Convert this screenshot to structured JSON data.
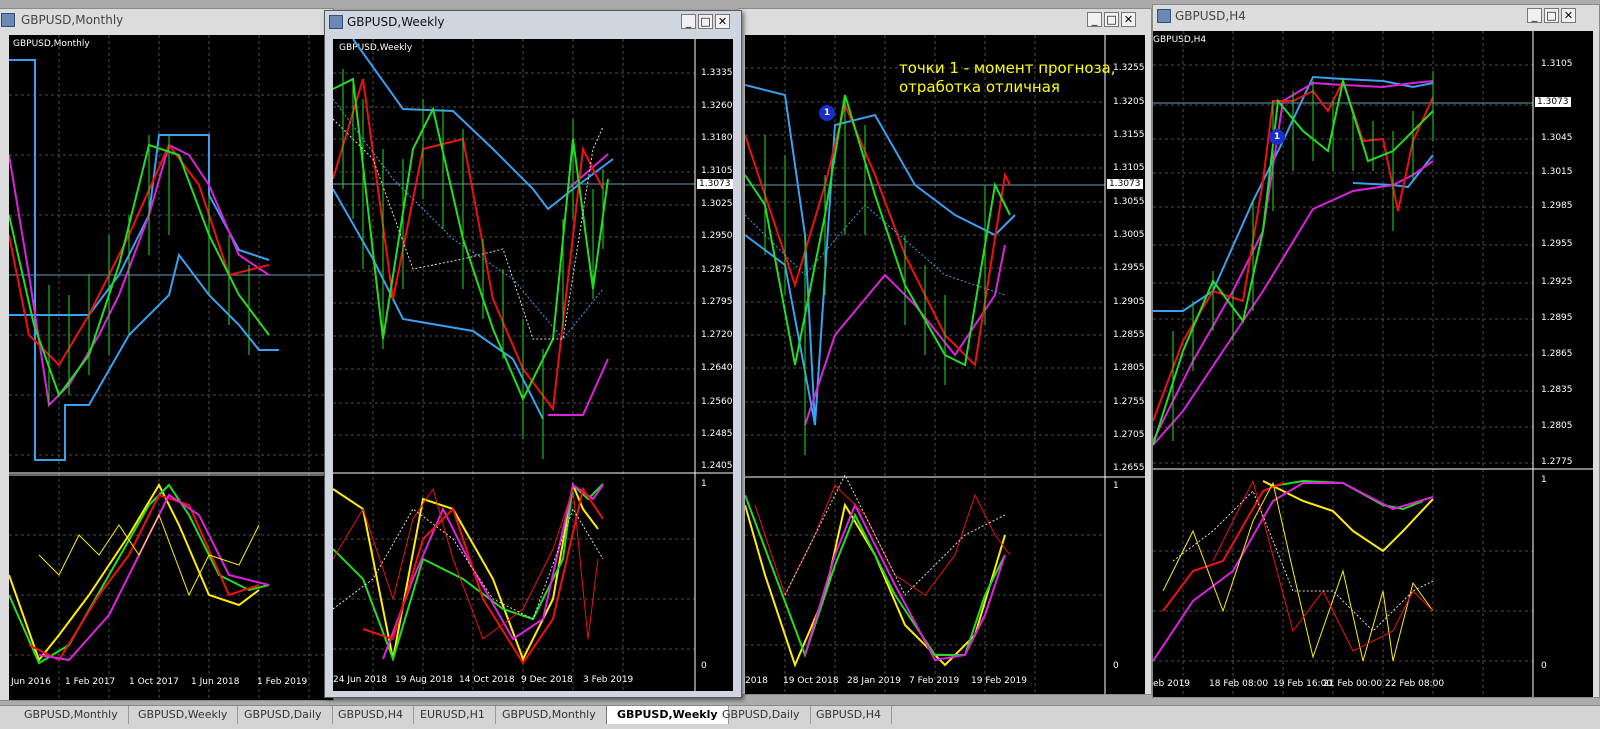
{
  "windows": {
    "monthly": {
      "title": "GBPUSD,Monthly",
      "chart_label": "GBPUSD,Monthly",
      "x_ticks": [
        "Jun 2016",
        "1 Feb 2017",
        "1 Oct 2017",
        "1 Jun 2018",
        "1 Feb 2019"
      ]
    },
    "weekly": {
      "title": "GBPUSD,Weekly",
      "chart_label": "GBPUSD,Weekly",
      "y_ticks": [
        "1.3335",
        "1.3260",
        "1.3180",
        "1.3105",
        "1.3025",
        "1.2950",
        "1.2875",
        "1.2795",
        "1.2720",
        "1.2640",
        "1.2560",
        "1.2485",
        "1.2405"
      ],
      "price_tag": "1.3073",
      "osc_ticks": [
        "1",
        "0"
      ],
      "x_ticks": [
        "24 Jun 2018",
        "19 Aug 2018",
        "14 Oct 2018",
        "9 Dec 2018",
        "3 Feb 2019"
      ]
    },
    "daily": {
      "title": "",
      "annotation_line1": "точки 1 - момент прогноза,",
      "annotation_line2": "отработка отличная",
      "marker": "1",
      "y_ticks": [
        "1.3255",
        "1.3205",
        "1.3155",
        "1.3105",
        "1.3055",
        "1.3005",
        "1.2955",
        "1.2905",
        "1.2855",
        "1.2805",
        "1.2755",
        "1.2705",
        "1.2655"
      ],
      "price_tag": "1.3073",
      "osc_ticks": [
        "1",
        "0"
      ],
      "x_ticks": [
        "2018",
        "19 Oct 2018",
        "28 Jan 2019",
        "7 Feb 2019",
        "19 Feb 2019"
      ]
    },
    "h4": {
      "title": "GBPUSD,H4",
      "chart_label": "GBPUSD,H4",
      "marker": "1",
      "y_ticks": [
        "1.3105",
        "1.3073",
        "1.3045",
        "1.3015",
        "1.2985",
        "1.2955",
        "1.2925",
        "1.2895",
        "1.2865",
        "1.2835",
        "1.2805",
        "1.2775"
      ],
      "price_tag": "1.3073",
      "osc_ticks": [
        "1",
        "0"
      ],
      "x_ticks": [
        "eb 2019",
        "18 Feb 08:00",
        "19 Feb 16:00",
        "21 Feb 00:00",
        "22 Feb 08:00"
      ]
    }
  },
  "tabs": [
    "GBPUSD,Monthly",
    "GBPUSD,Weekly",
    "GBPUSD,Daily",
    "GBPUSD,H4",
    "EURUSD,H1",
    "GBPUSD,Monthly",
    "GBPUSD,Weekly",
    "GBPUSD,Daily",
    "GBPUSD,H4"
  ],
  "active_tab_index": 6,
  "colors": {
    "background": "#000000",
    "grid": "#555555",
    "band": "#3aa0f0",
    "fast": "#22dd22",
    "slow": "#ee1111",
    "signal": "#dd22dd",
    "osc_yellow": "#ffee00"
  }
}
